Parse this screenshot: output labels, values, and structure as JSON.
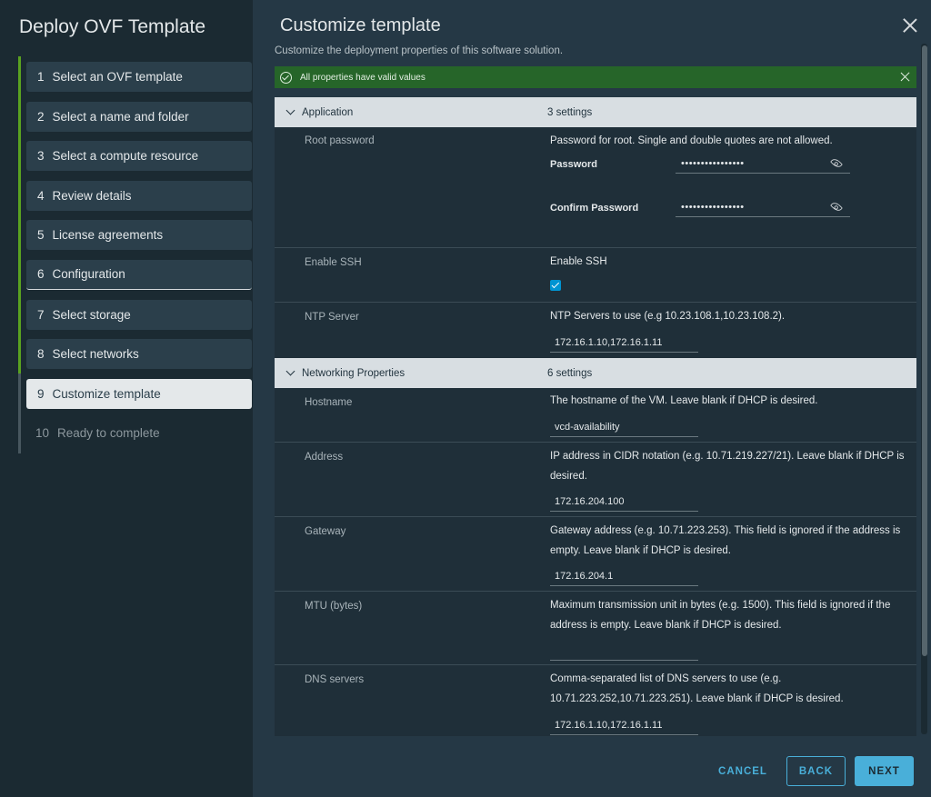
{
  "wizard": {
    "title": "Deploy OVF Template",
    "steps": [
      {
        "num": "1",
        "label": "Select an OVF template"
      },
      {
        "num": "2",
        "label": "Select a name and folder"
      },
      {
        "num": "3",
        "label": "Select a compute resource"
      },
      {
        "num": "4",
        "label": "Review details"
      },
      {
        "num": "5",
        "label": "License agreements"
      },
      {
        "num": "6",
        "label": "Configuration"
      },
      {
        "num": "7",
        "label": "Select storage"
      },
      {
        "num": "8",
        "label": "Select networks"
      },
      {
        "num": "9",
        "label": "Customize template"
      },
      {
        "num": "10",
        "label": "Ready to complete"
      }
    ]
  },
  "main": {
    "title": "Customize template",
    "subtitle": "Customize the deployment properties of this software solution.",
    "alert": "All properties have valid values"
  },
  "application": {
    "header": "Application",
    "count": "3 settings",
    "root_password": {
      "label": "Root password",
      "desc": "Password for root. Single and double quotes are not allowed.",
      "password_label": "Password",
      "password_value": "••••••••••••••••",
      "confirm_label": "Confirm Password",
      "confirm_value": "••••••••••••••••"
    },
    "enable_ssh": {
      "label": "Enable SSH",
      "desc": "Enable SSH"
    },
    "ntp": {
      "label": "NTP Server",
      "desc": "NTP Servers to use (e.g 10.23.108.1,10.23.108.2).",
      "value": "172.16.1.10,172.16.1.11"
    }
  },
  "networking": {
    "header": "Networking Properties",
    "count": "6 settings",
    "hostname": {
      "label": "Hostname",
      "desc": "The hostname of the VM. Leave blank if DHCP is desired.",
      "value": "vcd-availability"
    },
    "address": {
      "label": "Address",
      "desc": "IP address in CIDR notation (e.g. 10.71.219.227/21). Leave blank if DHCP is desired.",
      "value": "172.16.204.100"
    },
    "gateway": {
      "label": "Gateway",
      "desc": "Gateway address (e.g. 10.71.223.253). This field is ignored if the address is empty. Leave blank if DHCP is desired.",
      "value": "172.16.204.1"
    },
    "mtu": {
      "label": "MTU (bytes)",
      "desc": "Maximum transmission unit in bytes (e.g. 1500). This field is ignored if the address is empty. Leave blank if DHCP is desired.",
      "value": ""
    },
    "dns": {
      "label": "DNS servers",
      "desc": "Comma-separated list of DNS servers to use (e.g. 10.71.223.252,10.71.223.251). Leave blank if DHCP is desired.",
      "value": "172.16.1.10,172.16.1.11"
    }
  },
  "footer": {
    "cancel": "CANCEL",
    "back": "BACK",
    "next": "NEXT"
  }
}
